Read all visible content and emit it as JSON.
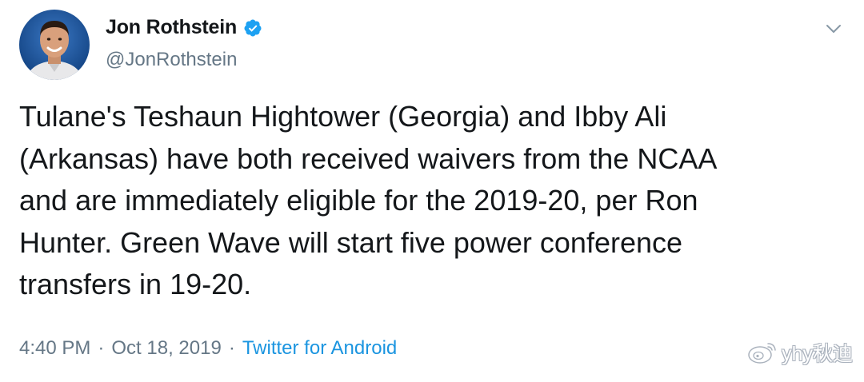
{
  "author": {
    "display_name": "Jon Rothstein",
    "handle": "@JonRothstein",
    "verified": true,
    "avatar_icon": "profile-photo"
  },
  "tweet": {
    "text": "Tulane's Teshaun Hightower (Georgia) and Ibby Ali\n(Arkansas) have both received waivers from the NCAA\nand are immediately eligible for the 2019-20, per Ron\nHunter. Green Wave will start five power conference\ntransfers in 19-20.",
    "time": "4:40 PM",
    "separator": "·",
    "date": "Oct 18, 2019",
    "source": "Twitter for Android"
  },
  "watermark": {
    "text": "yhy秋迪",
    "icon": "weibo-icon"
  },
  "colors": {
    "primary_text": "#14171a",
    "secondary_text": "#657786",
    "link": "#1b95e0",
    "verified_badge": "#1da1f2",
    "background": "#ffffff"
  },
  "icons": {
    "verified": "verified-badge-icon",
    "menu": "chevron-down-icon"
  }
}
